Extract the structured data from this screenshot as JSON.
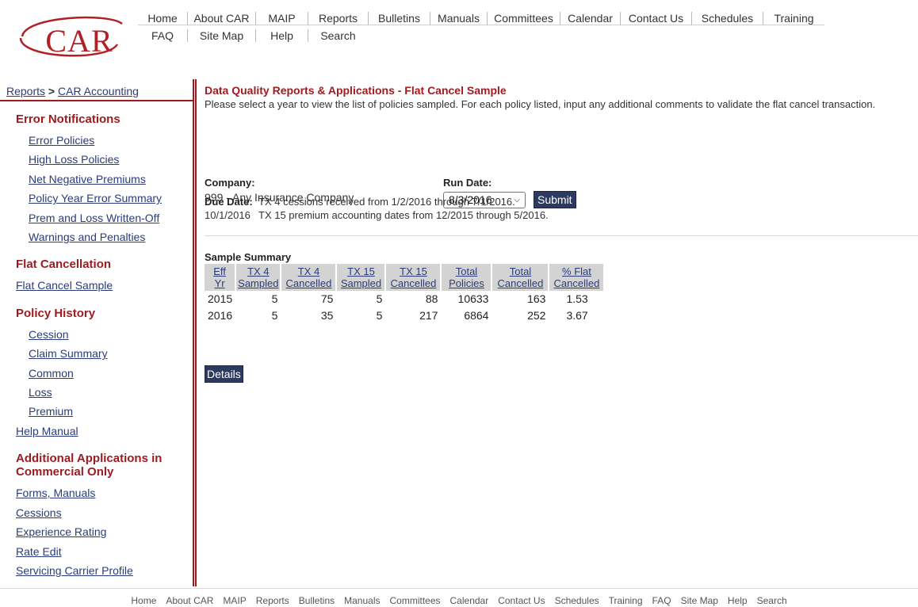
{
  "header": {
    "logo_text": "CAR",
    "nav_row1": [
      "Home",
      "About CAR",
      "MAIP",
      "Reports",
      "Bulletins",
      "Manuals",
      "Committees",
      "Calendar",
      "Contact Us",
      "Schedules",
      "Training"
    ],
    "nav_row2": [
      "FAQ",
      "Site Map",
      "Help",
      "Search"
    ]
  },
  "sidebar": {
    "breadcrumb": {
      "root": "Reports",
      "separator": ">",
      "current": "CAR Accounting"
    },
    "sections": [
      {
        "heading": "Error Notifications",
        "links": [
          "Error Policies",
          "High Loss Policies",
          "Net Negative Premiums",
          "Policy Year Error Summary",
          "Prem and Loss Written-Off",
          "Warnings and Penalties"
        ]
      },
      {
        "heading": "Flat Cancellation",
        "links": [
          "Flat Cancel Sample"
        ]
      },
      {
        "heading": "Policy History",
        "links": [
          "Cession",
          "Claim Summary",
          "Common",
          "Loss",
          "Premium"
        ]
      },
      {
        "links": [
          "Help Manual"
        ]
      },
      {
        "heading": "Additional Applications in Commercial Only",
        "links": [
          "Forms, Manuals",
          "Cessions",
          "Experience Rating",
          "Rate Edit",
          "Servicing Carrier Profile"
        ]
      }
    ]
  },
  "main": {
    "title": "Data Quality Reports & Applications - Flat Cancel Sample",
    "intro": "Please select a year to view the list of policies sampled. For each policy listed, input any additional comments to validate the flat cancel transaction.",
    "company_label": "Company:",
    "company_value": "999 - Any Insurance Company",
    "run_date_label": "Run Date:",
    "run_date_value": "8/3/2016",
    "submit_label": "Submit",
    "due_date_label": "Due Date:",
    "due_date_value": "10/1/2016",
    "due_line1": "TX 4 cessions received from 1/2/2016 through 7/1/2016.",
    "due_line2": "TX 15 premium accounting dates from 12/2015 through 5/2016.",
    "summary_title": "Sample Summary",
    "columns": [
      [
        "Eff",
        "Yr"
      ],
      [
        "TX 4",
        "Sampled"
      ],
      [
        "TX 4",
        "Cancelled"
      ],
      [
        "TX 15",
        "Sampled"
      ],
      [
        "TX 15",
        "Cancelled"
      ],
      [
        "Total",
        "Policies"
      ],
      [
        "Total",
        "Cancelled"
      ],
      [
        "% Flat",
        "Cancelled"
      ]
    ],
    "rows": [
      [
        "2015",
        "5",
        "75",
        "5",
        "88",
        "10633",
        "163",
        "1.53"
      ],
      [
        "2016",
        "5",
        "35",
        "5",
        "217",
        "6864",
        "252",
        "3.67"
      ]
    ],
    "details_label": "Details"
  },
  "footer": {
    "links": [
      "Home",
      "About CAR",
      "MAIP",
      "Reports",
      "Bulletins",
      "Manuals",
      "Committees",
      "Calendar",
      "Contact Us",
      "Schedules",
      "Training",
      "FAQ",
      "Site Map",
      "Help",
      "Search"
    ]
  },
  "colors": {
    "brand_red": "#9d1b1f",
    "link_blue": "#2a3c7a",
    "button": "#2c3a60"
  }
}
